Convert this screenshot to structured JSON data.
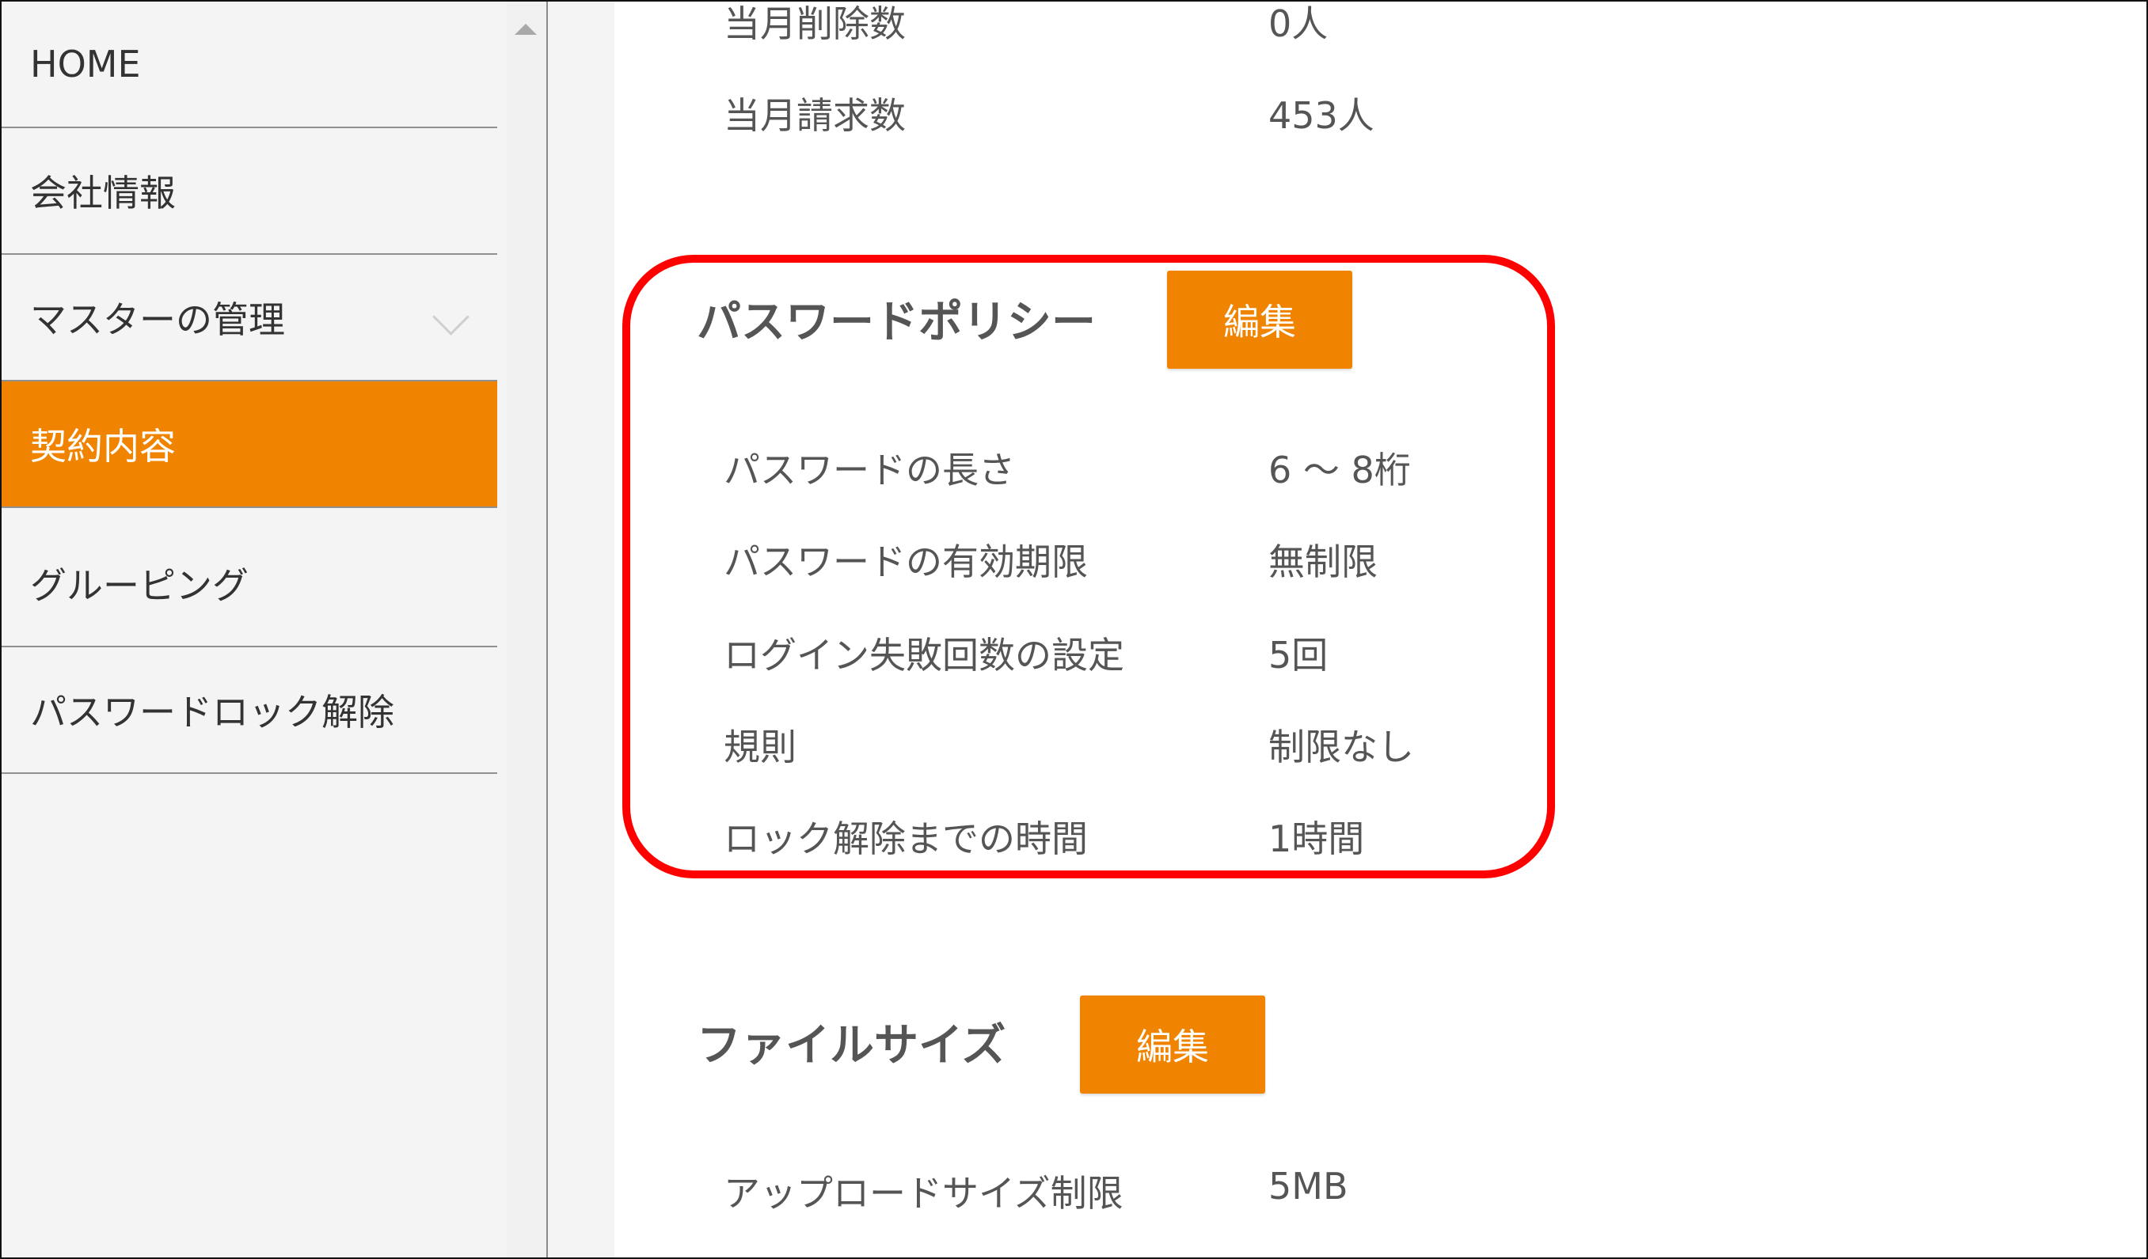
{
  "sidebar": {
    "items": [
      {
        "label": "HOME"
      },
      {
        "label": "会社情報"
      },
      {
        "label": "マスターの管理"
      },
      {
        "label": "契約内容"
      },
      {
        "label": "グルーピング"
      },
      {
        "label": "パスワードロック解除"
      }
    ],
    "active_item": "契約内容"
  },
  "usage": {
    "rows": [
      {
        "label": "当月削除数",
        "value": "0人"
      },
      {
        "label": "当月請求数",
        "value": "453人"
      }
    ]
  },
  "password_policy": {
    "title": "パスワードポリシー",
    "edit_label": "編集",
    "rows": [
      {
        "label": "パスワードの長さ",
        "value": "6 ～ 8桁"
      },
      {
        "label": "パスワードの有効期限",
        "value": "無制限"
      },
      {
        "label": "ログイン失敗回数の設定",
        "value": "5回"
      },
      {
        "label": "規則",
        "value": "制限なし"
      },
      {
        "label": "ロック解除までの時間",
        "value": "1時間"
      }
    ]
  },
  "file_size": {
    "title": "ファイルサイズ",
    "edit_label": "編集",
    "rows": [
      {
        "label": "アップロードサイズ制限",
        "value": "5MB"
      }
    ]
  },
  "colors": {
    "accent": "#f08300",
    "highlight": "#ff0000",
    "text": "#555555",
    "sidebar_bg": "#f4f4f4"
  }
}
